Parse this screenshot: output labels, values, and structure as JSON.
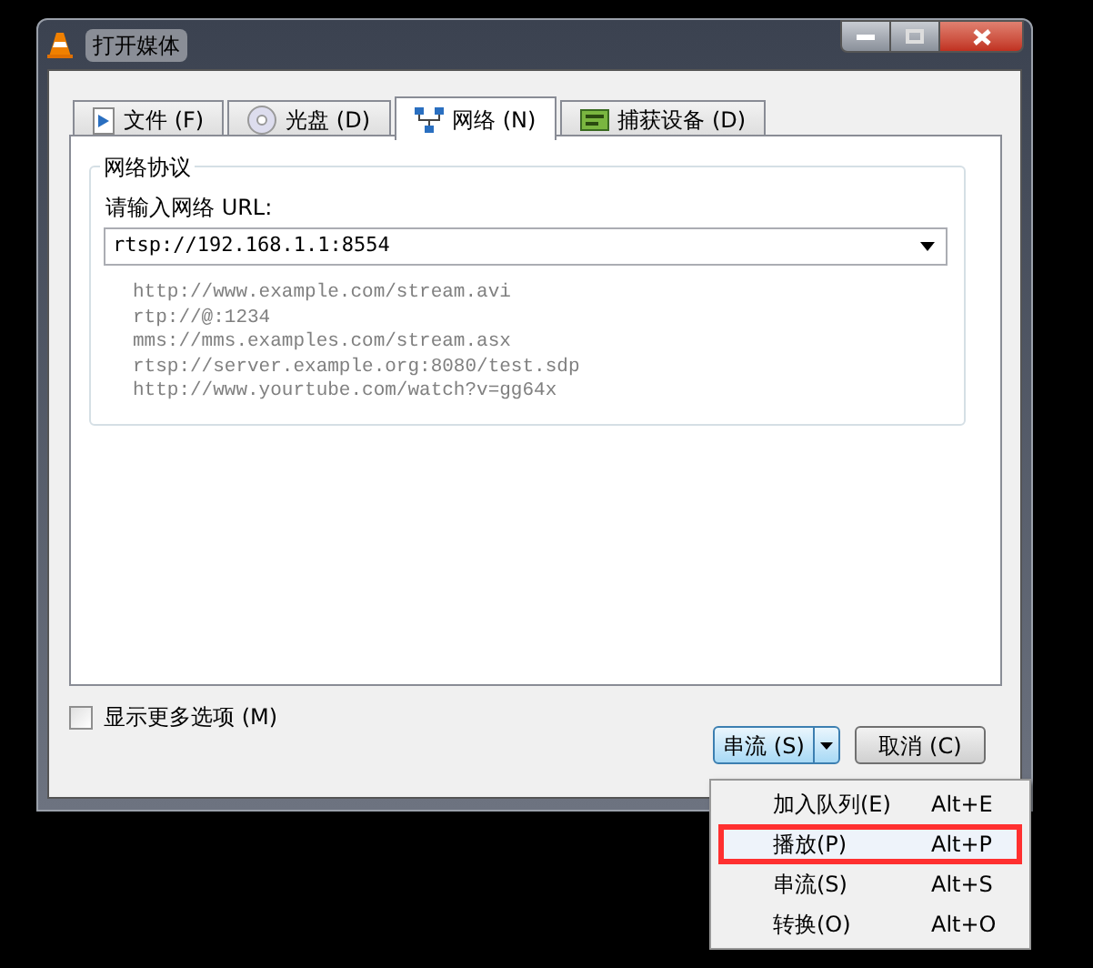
{
  "window": {
    "title": "打开媒体"
  },
  "tabs": [
    {
      "label": "文件 (F)",
      "kind": "file",
      "selected": false
    },
    {
      "label": "光盘 (D)",
      "kind": "disc",
      "selected": false
    },
    {
      "label": "网络 (N)",
      "kind": "network",
      "selected": true
    },
    {
      "label": "捕获设备 (D)",
      "kind": "capture",
      "selected": false
    }
  ],
  "group": {
    "title": "网络协议",
    "prompt": "请输入网络 URL:",
    "url": {
      "value": "rtsp://192.168.1.1:8554"
    },
    "examples": [
      "http://www.example.com/stream.avi",
      "rtp://@:1234",
      "mms://mms.examples.com/stream.asx",
      "rtsp://server.example.org:8080/test.sdp",
      "http://www.yourtube.com/watch?v=gg64x"
    ]
  },
  "more_options": {
    "label": "显示更多选项 (M)",
    "checked": false
  },
  "buttons": {
    "primary": "串流 (S)",
    "cancel": "取消 (C)"
  },
  "menu": [
    {
      "label": "加入队列(E)",
      "shortcut": "Alt+E",
      "selected": false
    },
    {
      "label": "播放(P)",
      "shortcut": "Alt+P",
      "selected": true
    },
    {
      "label": "串流(S)",
      "shortcut": "Alt+S",
      "selected": false
    },
    {
      "label": "转换(O)",
      "shortcut": "Alt+O",
      "selected": false
    }
  ]
}
